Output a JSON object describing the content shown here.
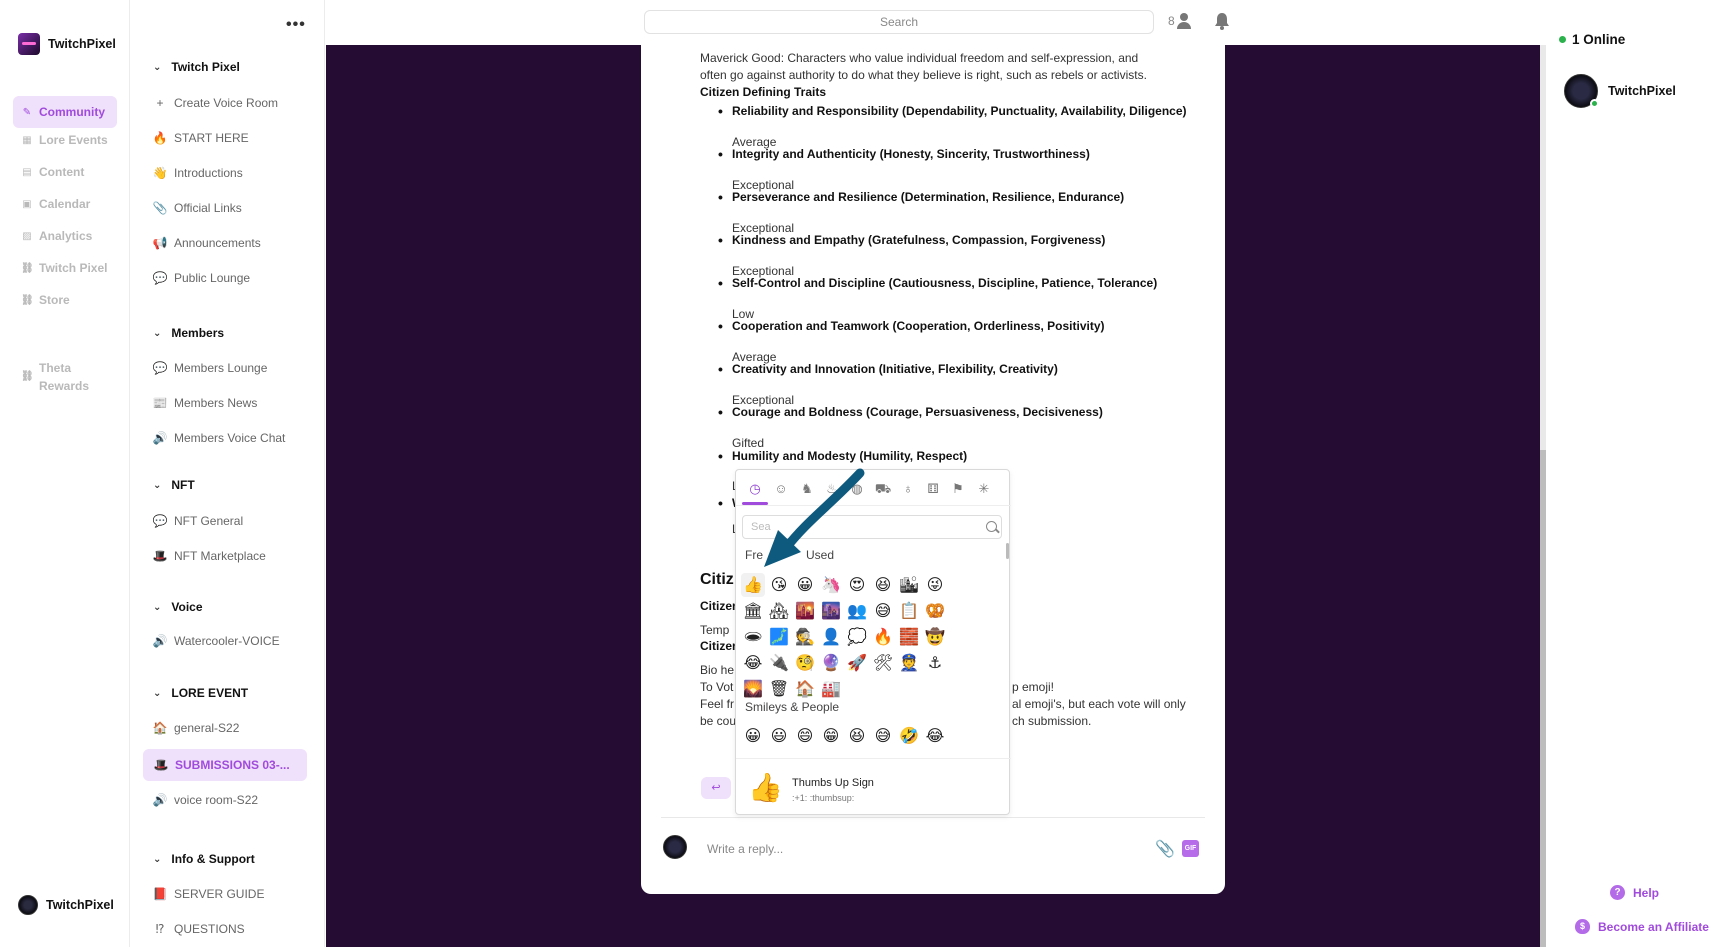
{
  "brand": {
    "name": "TwitchPixel"
  },
  "nav": [
    {
      "label": "Community",
      "icon": "pen-icon"
    },
    {
      "label": "Lore Events",
      "icon": "grid-icon"
    },
    {
      "label": "Content",
      "icon": "doc-icon"
    },
    {
      "label": "Calendar",
      "icon": "calendar-icon"
    },
    {
      "label": "Analytics",
      "icon": "chart-icon"
    },
    {
      "label": "Twitch Pixel",
      "icon": "link-icon"
    },
    {
      "label": "Store",
      "icon": "link-icon"
    },
    {
      "label_line1": "Theta",
      "label_line2": "Rewards",
      "icon": "link-icon"
    }
  ],
  "current_user": {
    "name": "TwitchPixel"
  },
  "channels": {
    "sections": [
      {
        "title": "Twitch Pixel"
      },
      {
        "title": "Members"
      },
      {
        "title": "NFT"
      },
      {
        "title": "Voice"
      },
      {
        "title": "LORE EVENT"
      },
      {
        "title": "Info & Support"
      }
    ],
    "items": [
      {
        "label": "Create Voice Room",
        "emoji": "+"
      },
      {
        "label": "START HERE",
        "emoji": "🔥"
      },
      {
        "label": "Introductions",
        "emoji": "👋"
      },
      {
        "label": "Official Links",
        "emoji": "📎"
      },
      {
        "label": "Announcements",
        "emoji": "📢"
      },
      {
        "label": "Public Lounge",
        "emoji": "💬"
      },
      {
        "label": "Members Lounge",
        "emoji": "💬"
      },
      {
        "label": "Members News",
        "emoji": "📰"
      },
      {
        "label": "Members Voice Chat",
        "emoji": "🔊"
      },
      {
        "label": "NFT General",
        "emoji": "💬"
      },
      {
        "label": "NFT Marketplace",
        "emoji": "🎩"
      },
      {
        "label": "Watercooler-VOICE",
        "emoji": "🔊"
      },
      {
        "label": "general-S22",
        "emoji": "🏠"
      },
      {
        "label": "SUBMISSIONS 03-...",
        "emoji": "🎩"
      },
      {
        "label": "voice room-S22",
        "emoji": "🔊"
      },
      {
        "label": "SERVER GUIDE",
        "emoji": "📕"
      },
      {
        "label": "QUESTIONS",
        "emoji": "⁉"
      }
    ]
  },
  "topbar": {
    "search_placeholder": "Search",
    "member_count": "8"
  },
  "post": {
    "intro_line1": "Maverick Good: Characters who value individual freedom and self-expression, and",
    "intro_line2": "often go against authority to do what they believe is right, such as rebels or activists.",
    "traits_heading": "Citizen Defining Traits",
    "traits": [
      {
        "name": "Reliability and Responsibility (Dependability, Punctuality, Availability, Diligence)",
        "rating": "Average"
      },
      {
        "name": "Integrity and Authenticity (Honesty, Sincerity, Trustworthiness)",
        "rating": "Exceptional"
      },
      {
        "name": "Perseverance and Resilience (Determination, Resilience, Endurance)",
        "rating": "Exceptional"
      },
      {
        "name": "Kindness and Empathy (Gratefulness, Compassion, Forgiveness)",
        "rating": "Exceptional"
      },
      {
        "name": "Self-Control and Discipline (Cautiousness, Discipline, Patience, Tolerance)",
        "rating": "Low"
      },
      {
        "name": "Cooperation and Teamwork (Cooperation, Orderliness, Positivity)",
        "rating": "Average"
      },
      {
        "name": "Creativity and Innovation (Initiative, Flexibility, Creativity)",
        "rating": "Exceptional"
      },
      {
        "name": "Courage and Boldness (Courage, Persuasiveness, Decisiveness)",
        "rating": "Gifted"
      },
      {
        "name": "Humility and Modesty (Humility, Respect)",
        "rating": ""
      }
    ],
    "partial_L1": "L",
    "partial_W": "W",
    "partial_L2": "L",
    "section_title": "Citiz",
    "line_citizen1": "Citizen",
    "line_temp": "Temp",
    "line_citizen2": "Citizen",
    "line_bio": "Bio he",
    "line_vote_left": "To Vot",
    "line_vote_right": "p emoji!",
    "line_feel_left": "Feel fr",
    "line_feel_right": "al emoji's, but each vote will only",
    "line_be_left": "be cou",
    "line_be_right": "ch submission.",
    "react_glyph": "↩",
    "reply_placeholder": "Write a reply...",
    "gif_label": "GIF"
  },
  "emoji_picker": {
    "search_placeholder": "Sea",
    "frequently_used_left": "Fre",
    "frequently_used_right": "Used",
    "smileys_label": "Smileys & People",
    "frequent": [
      "👍",
      "😘",
      "😀",
      "🦄",
      "😍",
      "😆",
      "🏙",
      "😜",
      "🏛",
      "🏘",
      "🌇",
      "🌆",
      "👥",
      "😅",
      "📋",
      "🥨",
      "🕳",
      "🗾",
      "🕵",
      "👤",
      "💭",
      "🔥",
      "🧱",
      "🤠",
      "😂",
      "🔌",
      "🧐",
      "🔮",
      "🚀",
      "🛠",
      "👮",
      "⚓",
      "🌄",
      "🗑",
      "🏠",
      "🏭"
    ],
    "smileys": [
      "😀",
      "😃",
      "😄",
      "😁",
      "😆",
      "😅",
      "🤣",
      "😂"
    ],
    "categories": [
      "clock-icon",
      "smiley-icon",
      "animal-icon",
      "food-icon",
      "ball-icon",
      "car-icon",
      "bulb-icon",
      "symbols-icon",
      "flag-icon",
      "custom-icon"
    ],
    "preview": {
      "emoji": "👍",
      "name": "Thumbs Up Sign",
      "codes": ":+1:  :thumbsup:"
    }
  },
  "right": {
    "online_label": "1 Online",
    "member_name": "TwitchPixel",
    "help_label": "Help",
    "affiliate_label": "Become an Affiliate"
  },
  "colors": {
    "accent": "#a14bdc",
    "accent_bg": "#efe0fb",
    "main_bg": "#250c33",
    "online": "#2bb24c",
    "arrow": "#0e5a7e"
  }
}
